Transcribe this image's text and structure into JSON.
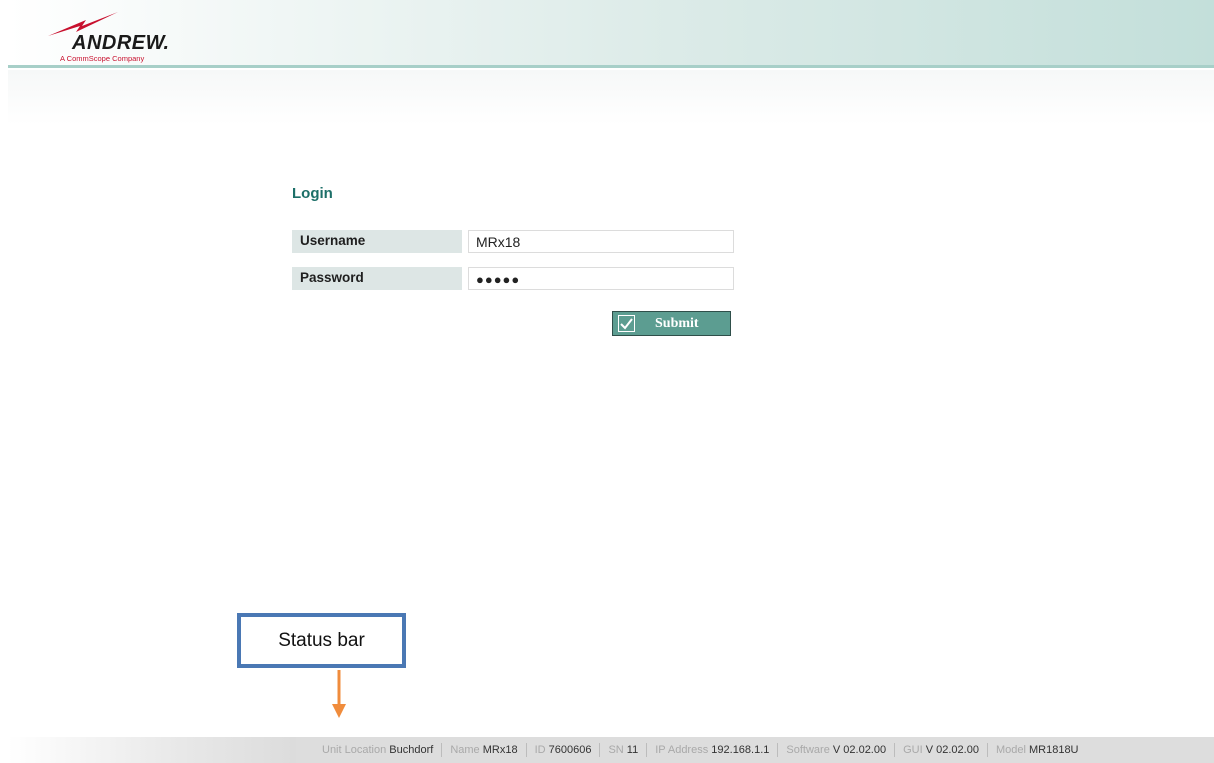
{
  "header": {
    "logo_name": "ANDREW.",
    "logo_tagline": "A CommScope Company"
  },
  "login": {
    "title": "Login",
    "username_label": "Username",
    "username_value": "MRx18",
    "password_label": "Password",
    "password_mask": "●●●●●",
    "submit_label": "Submit"
  },
  "annotation": {
    "text": "Status bar"
  },
  "status_bar": {
    "unit_location_label": "Unit Location",
    "unit_location_value": "Buchdorf",
    "name_label": "Name",
    "name_value": "MRx18",
    "id_label": "ID",
    "id_value": "7600606",
    "sn_label": "SN",
    "sn_value": "11",
    "ip_label": "IP Address",
    "ip_value": "192.168.1.1",
    "software_label": "Software",
    "software_value": "V 02.02.00",
    "gui_label": "GUI",
    "gui_value": "V 02.02.00",
    "model_label": "Model",
    "model_value": "MR1818U"
  },
  "colors": {
    "accent": "#1c6f68",
    "button": "#5c9d91",
    "callout_border": "#4a78b4",
    "arrow": "#f08c3c"
  }
}
